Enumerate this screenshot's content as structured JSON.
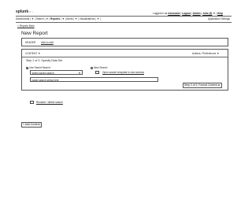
{
  "topbar": {
    "logo": "splunk",
    "logo_suffix": "> ...",
    "login_text": "Logged in as",
    "user_name": "Username",
    "logout": "Logout",
    "admin": "Admin",
    "jobs": "Jobs (3)",
    "help": "Help"
  },
  "navbar": {
    "items": [
      "Dashboards",
      "Search",
      "Reports",
      "Alerts",
      "Visualizations"
    ],
    "caret": "▼",
    "right_text": "Application Settings"
  },
  "breadcrumb": "< Reports Main",
  "page_title": "New Report",
  "header_panel": {
    "label": "HEADER",
    "link": "click to edit"
  },
  "content_panel": {
    "label": "CONTENT",
    "label_caret": "▼",
    "actions": "Actions / Preferences",
    "actions_caret": "▼",
    "step_title": "Step 1 of 2: Specify Data Set",
    "use_saved_label": "Use Saved Search:",
    "new_search_label": "New Search",
    "saved_search_select": "select saved search",
    "open_template_link": "Open search template in new window",
    "search_input_value": "paste search string here",
    "next_button": "Step 2 of 2: Format Content"
  },
  "rename_link": "Rename / define search",
  "add_content_button": "+ Add Content"
}
